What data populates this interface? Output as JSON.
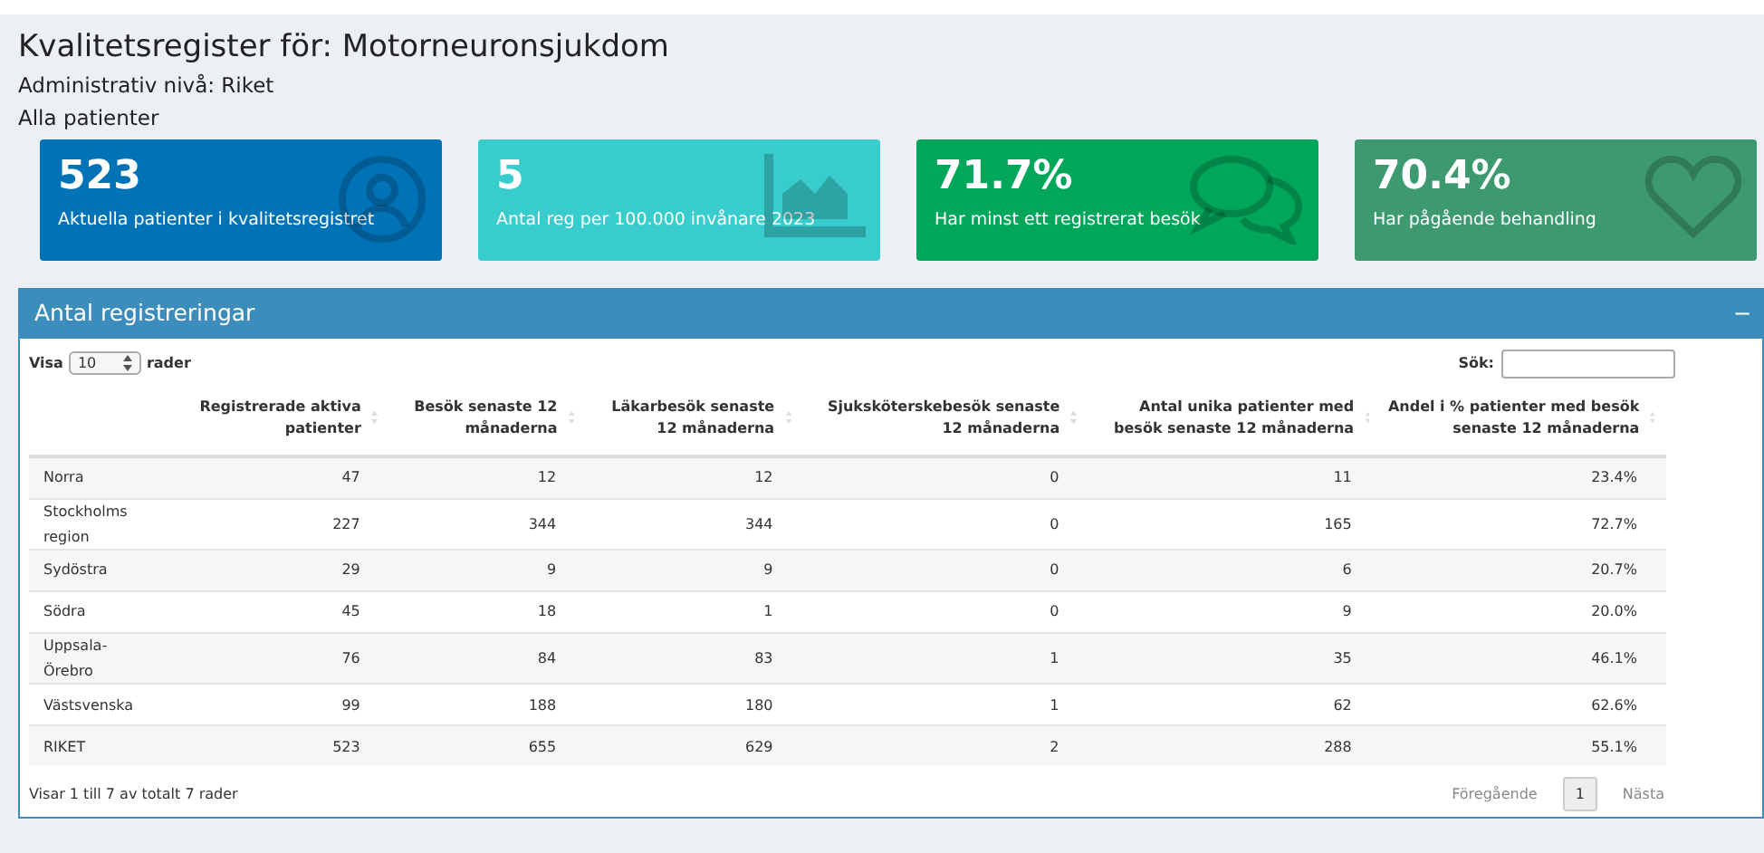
{
  "header": {
    "title": "Kvalitetsregister för: Motorneuronsjukdom",
    "level": "Administrativ nivå: Riket",
    "filter": "Alla patienter"
  },
  "cards": [
    {
      "value": "523",
      "label": "Aktuella patienter i kvalitetsregistret",
      "color": "#0073b7"
    },
    {
      "value": "5",
      "label": "Antal reg per 100.000 invånare 2023",
      "color": "#39cccc"
    },
    {
      "value": "71.7%",
      "label": "Har minst ett registrerat besök",
      "color": "#00a65a"
    },
    {
      "value": "70.4%",
      "label": "Har pågående behandling",
      "color": "#3d9970"
    }
  ],
  "panel": {
    "title": "Antal registreringar",
    "collapse": "−",
    "length": {
      "before": "Visa",
      "value": "10",
      "after": "rader"
    },
    "search": {
      "label": "Sök:"
    },
    "table": {
      "columns": [
        "",
        "Registrerade aktiva patienter",
        "Besök senaste 12 månaderna",
        "Läkarbesök senaste 12 månaderna",
        "Sjuksköterskebesök senaste 12 månaderna",
        "Antal unika patienter med besök senaste 12 månaderna",
        "Andel i % patienter med besök senaste 12 månaderna"
      ],
      "rows": [
        [
          "Norra",
          "47",
          "12",
          "12",
          "0",
          "11",
          "23.4%"
        ],
        [
          "Stockholms region",
          "227",
          "344",
          "344",
          "0",
          "165",
          "72.7%"
        ],
        [
          "Sydöstra",
          "29",
          "9",
          "9",
          "0",
          "6",
          "20.7%"
        ],
        [
          "Södra",
          "45",
          "18",
          "1",
          "0",
          "9",
          "20.0%"
        ],
        [
          "Uppsala-Örebro",
          "76",
          "84",
          "83",
          "1",
          "35",
          "46.1%"
        ],
        [
          "Västsvenska",
          "99",
          "188",
          "180",
          "1",
          "62",
          "62.6%"
        ],
        [
          "RIKET",
          "523",
          "655",
          "629",
          "2",
          "288",
          "55.1%"
        ]
      ]
    },
    "info": "Visar 1 till 7 av totalt 7 rader",
    "pagination": {
      "previous": {
        "label": "Föregående",
        "disabled": true
      },
      "pages": [
        {
          "label": "1",
          "selected": true
        }
      ],
      "next": {
        "label": "Nästa",
        "disabled": true
      }
    }
  }
}
